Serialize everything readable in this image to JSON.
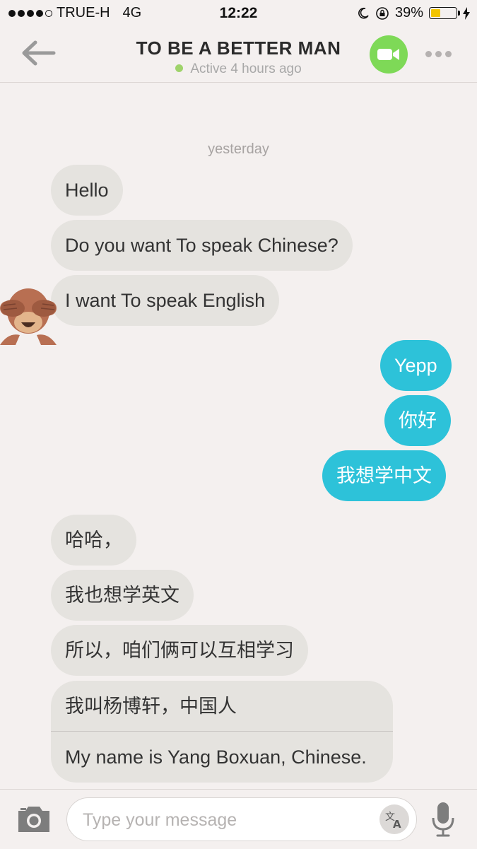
{
  "status_bar": {
    "carrier": "TRUE-H",
    "network": "4G",
    "time": "12:22",
    "battery_percent": "39%",
    "battery_level": 0.39,
    "signal_icon": "signal-dots-icon",
    "moon_icon": "moon-icon",
    "lock_icon": "rotation-lock-icon",
    "charging_icon": "charging-bolt-icon"
  },
  "header": {
    "title": "TO BE A BETTER MAN",
    "subtitle": "Active 4 hours ago",
    "online_color": "#9fd36b",
    "back_icon": "back-arrow-icon",
    "video_icon": "video-camera-icon",
    "more_icon": "more-dots-icon"
  },
  "conversation": {
    "date_label": "yesterday",
    "incoming_color": "#e5e3df",
    "outgoing_color": "#2dc2d9",
    "messages": [
      {
        "direction": "in",
        "text": "Hello"
      },
      {
        "direction": "in",
        "text": "Do you want To speak Chinese?"
      },
      {
        "direction": "in",
        "text": "I want To speak English"
      },
      {
        "direction": "out",
        "text": "Yepp"
      },
      {
        "direction": "out",
        "text": "你好"
      },
      {
        "direction": "out",
        "text": "我想学中文"
      },
      {
        "direction": "in",
        "text": "哈哈，"
      },
      {
        "direction": "in",
        "text": "我也想学英文"
      },
      {
        "direction": "in",
        "text": "所以，咱们俩可以互相学习"
      },
      {
        "direction": "in",
        "text": "我叫杨博轩，中国人",
        "translation": "My name is Yang Boxuan, Chinese."
      }
    ],
    "avatar_icon": "monkey-see-no-evil-icon"
  },
  "composer": {
    "placeholder": "Type your message",
    "value": "",
    "camera_icon": "camera-icon",
    "translate_icon": "translate-icon",
    "mic_icon": "microphone-icon"
  }
}
